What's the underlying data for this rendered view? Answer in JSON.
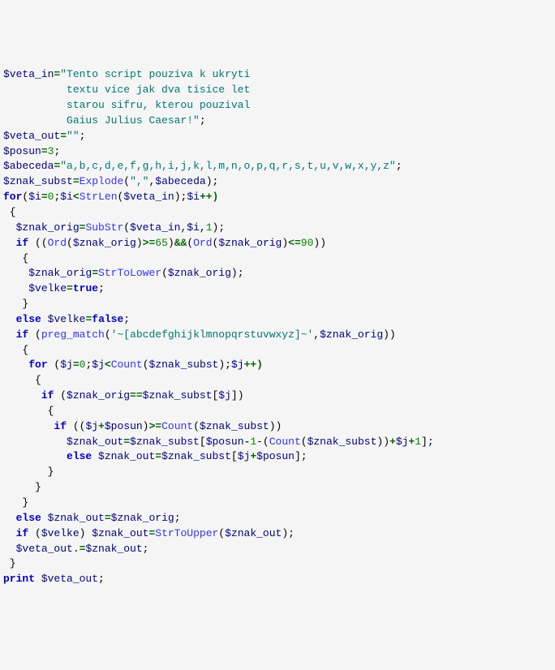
{
  "code": {
    "l1a": "$veta_in",
    "l1b": "=",
    "l1c": "\"Tento script pouziva k ukryti ",
    "l2": "          textu vice jak dva tisice let",
    "l3": "          starou sifru, kterou pouzival",
    "l4": "          Gaius Julius Caesar!\"",
    "l4p": ";",
    "l5a": "$veta_out",
    "l5b": "=",
    "l5c": "\"\"",
    "l5p": ";",
    "l6a": "$posun",
    "l6b": "=",
    "l6c": "3",
    "l6p": ";",
    "l7a": "$abeceda",
    "l7b": "=",
    "l7c": "\"a,b,c,d,e,f,g,h,i,j,k,l,m,n,o,p,q,r,s,t,u,v,w,x,y,z\"",
    "l7p": ";",
    "l8a": "$znak_subst",
    "l8b": "=",
    "l8c": "Explode",
    "l8d": "(",
    "l8e": "\",\"",
    "l8f": ",",
    "l8g": "$abeceda",
    "l8h": ");",
    "l9a": "for",
    "l9b": "(",
    "l9c": "$i",
    "l9d": "=",
    "l9e": "0",
    "l9f": ";",
    "l9g": "$i",
    "l9h": "<",
    "l9i": "StrLen",
    "l9j": "(",
    "l9k": "$veta_in",
    "l9l": ");",
    "l9m": "$i",
    "l9n": "++)",
    "l10": " {",
    "l11a": "  ",
    "l11b": "$znak_orig",
    "l11c": "=",
    "l11d": "SubStr",
    "l11e": "(",
    "l11f": "$veta_in",
    "l11g": ",",
    "l11h": "$i",
    "l11i": ",",
    "l11j": "1",
    "l11k": ");",
    "l12a": "  ",
    "l12b": "if",
    "l12c": " ((",
    "l12d": "Ord",
    "l12e": "(",
    "l12f": "$znak_orig",
    "l12g": ")",
    "l12h": ">=",
    "l12i": "65",
    "l12j": ")",
    "l12k": "&&",
    "l12l": "(",
    "l12m": "Ord",
    "l12n": "(",
    "l12o": "$znak_orig",
    "l12p": ")",
    "l12q": "<=",
    "l12r": "90",
    "l12s": "))",
    "l13": "   {",
    "l14a": "    ",
    "l14b": "$znak_orig",
    "l14c": "=",
    "l14d": "StrToLower",
    "l14e": "(",
    "l14f": "$znak_orig",
    "l14g": ");",
    "l15a": "    ",
    "l15b": "$velke",
    "l15c": "=",
    "l15d": "true",
    "l15e": ";",
    "l16": "   }",
    "l17a": "  ",
    "l17b": "else",
    "l17c": " ",
    "l17d": "$velke",
    "l17e": "=",
    "l17f": "false",
    "l17g": ";",
    "l18a": "  ",
    "l18b": "if",
    "l18c": " (",
    "l18d": "preg_match",
    "l18e": "(",
    "l18f": "'~[abcdefghijklmnopqrstuvwxyz]~'",
    "l18g": ",",
    "l18h": "$znak_orig",
    "l18i": "))",
    "l19": "   {",
    "l20a": "    ",
    "l20b": "for",
    "l20c": " (",
    "l20d": "$j",
    "l20e": "=",
    "l20f": "0",
    "l20g": ";",
    "l20h": "$j",
    "l20i": "<",
    "l20j": "Count",
    "l20k": "(",
    "l20l": "$znak_subst",
    "l20m": ");",
    "l20n": "$j",
    "l20o": "++)",
    "l21": "     {",
    "l22a": "      ",
    "l22b": "if",
    "l22c": " (",
    "l22d": "$znak_orig",
    "l22e": "==",
    "l22f": "$znak_subst",
    "l22g": "[",
    "l22h": "$j",
    "l22i": "])",
    "l23": "       {",
    "l24a": "        ",
    "l24b": "if",
    "l24c": " ((",
    "l24d": "$j",
    "l24e": "+",
    "l24f": "$posun",
    "l24g": ")",
    "l24h": ">=",
    "l24i": "Count",
    "l24j": "(",
    "l24k": "$znak_subst",
    "l24l": "))",
    "l25a": "          ",
    "l25b": "$znak_out",
    "l25c": "=",
    "l25d": "$znak_subst",
    "l25e": "[",
    "l25f": "$posun",
    "l25g": "-",
    "l25h": "1",
    "l25i": "-(",
    "l25j": "Count",
    "l25k": "(",
    "l25l": "$znak_subst",
    "l25m": "))",
    "l25n": "+",
    "l25o": "$j",
    "l25p": "+",
    "l25q": "1",
    "l25r": "];",
    "l26a": "          ",
    "l26b": "else",
    "l26c": " ",
    "l26d": "$znak_out",
    "l26e": "=",
    "l26f": "$znak_subst",
    "l26g": "[",
    "l26h": "$j",
    "l26i": "+",
    "l26j": "$posun",
    "l26k": "];",
    "l27": "       }",
    "l28": "     }",
    "l29": "   }",
    "l30a": "  ",
    "l30b": "else",
    "l30c": " ",
    "l30d": "$znak_out",
    "l30e": "=",
    "l30f": "$znak_orig",
    "l30g": ";",
    "l31a": "  ",
    "l31b": "if",
    "l31c": " (",
    "l31d": "$velke",
    "l31e": ") ",
    "l31f": "$znak_out",
    "l31g": "=",
    "l31h": "StrToUpper",
    "l31i": "(",
    "l31j": "$znak_out",
    "l31k": ");",
    "l32a": "  ",
    "l32b": "$veta_out",
    "l32c": ".=",
    "l32d": "$znak_out",
    "l32e": ";",
    "l33": " }",
    "l34a": "print",
    "l34b": " ",
    "l34c": "$veta_out",
    "l34d": ";"
  }
}
